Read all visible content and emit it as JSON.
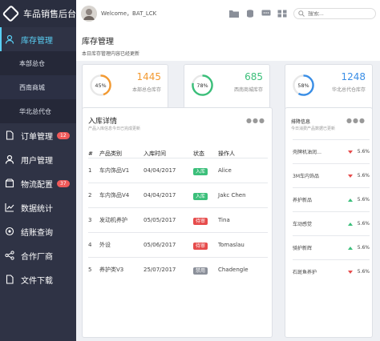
{
  "brand": {
    "title": "车品销售后台"
  },
  "menu": {
    "items": [
      {
        "label": "库存管理"
      },
      {
        "label": "订单管理",
        "badge": "12"
      },
      {
        "label": "用户管理"
      },
      {
        "label": "物流配置",
        "badge": "37"
      },
      {
        "label": "数据统计"
      },
      {
        "label": "结账查询"
      },
      {
        "label": "合作厂商"
      },
      {
        "label": "文件下载"
      }
    ],
    "sub_items": [
      {
        "label": "本部总仓"
      },
      {
        "label": "西南商城"
      },
      {
        "label": "华北总代仓"
      }
    ]
  },
  "topbar": {
    "welcome": "Welcome，BAT_LCK",
    "search_placeholder": "搜索..."
  },
  "page": {
    "title": "库存管理",
    "subtitle": "本日库存管理内容已经更新"
  },
  "stats": [
    {
      "percent": 45,
      "percent_label": "45%",
      "value": "1445",
      "label": "本部总仓库存",
      "color": "#f39a32"
    },
    {
      "percent": 78,
      "percent_label": "78%",
      "value": "685",
      "label": "西南商城库存",
      "color": "#3bbf7a"
    },
    {
      "percent": 58,
      "percent_label": "58%",
      "value": "1248",
      "label": "华北总代仓库存",
      "color": "#3a8ee6"
    }
  ],
  "inbound": {
    "title": "入库详情",
    "subtitle": "产品入库信息今日已完成更新",
    "headers": [
      "#",
      "产品类别",
      "入库时间",
      "状态",
      "操作人"
    ],
    "rows": [
      {
        "no": "1",
        "category": "车内饰品V1",
        "date": "04/04/2017",
        "status": "入库",
        "status_type": "in",
        "operator": "Alice"
      },
      {
        "no": "2",
        "category": "车内饰品V4",
        "date": "04/04/2017",
        "status": "入库",
        "status_type": "in",
        "operator": "Jakc Chen"
      },
      {
        "no": "3",
        "category": "发动机养护",
        "date": "05/05/2017",
        "status": "待审",
        "status_type": "wait",
        "operator": "Tina"
      },
      {
        "no": "4",
        "category": "外设",
        "date": "05/06/2017",
        "status": "待审",
        "status_type": "wait",
        "operator": "Tomaslau"
      },
      {
        "no": "5",
        "category": "养护类V3",
        "date": "25/07/2017",
        "status": "禁用",
        "status_type": "off",
        "operator": "Chadengle"
      }
    ]
  },
  "ranking": {
    "title": "排降信息",
    "subtitle": "今日消费产品数据已更新",
    "items": [
      {
        "name": "壳牌机油润…",
        "change": "5.6%",
        "direction": "down"
      },
      {
        "name": "3M车内饰品",
        "change": "5.6%",
        "direction": "down"
      },
      {
        "name": "养护新品",
        "change": "5.6%",
        "direction": "up"
      },
      {
        "name": "车动感觉",
        "change": "5.6%",
        "direction": "up"
      },
      {
        "name": "骑护新辉",
        "change": "5.6%",
        "direction": "up"
      },
      {
        "name": "石斑鱼养护",
        "change": "5.6%",
        "direction": "down"
      }
    ]
  }
}
